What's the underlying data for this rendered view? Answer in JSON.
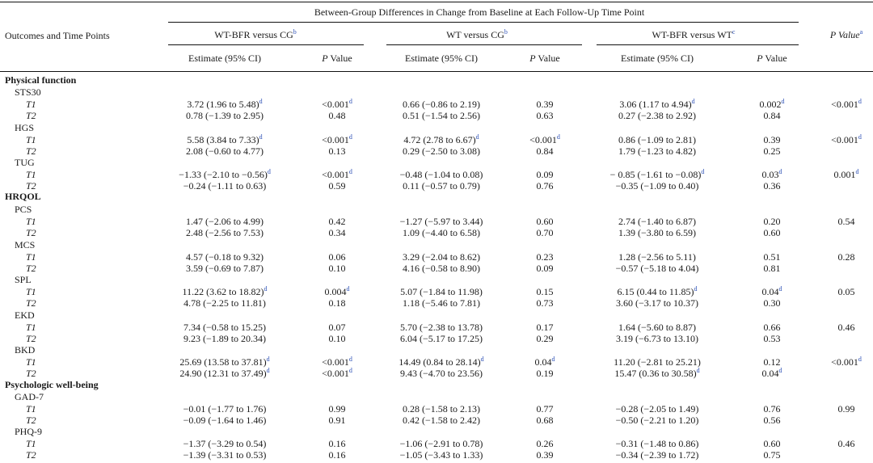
{
  "header": {
    "group_title": "Between-Group Differences in Change from Baseline at Each Follow-Up Time Point",
    "outcomes_col": "Outcomes and Time Points",
    "comparisons": [
      {
        "label": "WT-BFR versus CG",
        "sup": "b"
      },
      {
        "label": "WT versus CG",
        "sup": "b"
      },
      {
        "label": "WT-BFR versus WT",
        "sup": "c"
      }
    ],
    "pvalue_overall": {
      "label": "P Value",
      "sup": "a"
    },
    "estimate_label": "Estimate (95% CI)",
    "pvalue_label": "P Value"
  },
  "sections": [
    "Physical function",
    "HRQOL",
    "Psychologic well-being"
  ],
  "outcomes": [
    {
      "name": "STS30",
      "overall_p": "<0.001",
      "overall_sup": "d",
      "rows": [
        {
          "tp": "T1",
          "cells": [
            {
              "est": "3.72 (1.96 to 5.48)",
              "est_sup": "d",
              "p": "<0.001",
              "p_sup": "d"
            },
            {
              "est": "0.66 (−0.86 to 2.19)",
              "est_sup": "",
              "p": "0.39",
              "p_sup": ""
            },
            {
              "est": "3.06 (1.17 to 4.94)",
              "est_sup": "d",
              "p": "0.002",
              "p_sup": "d"
            }
          ]
        },
        {
          "tp": "T2",
          "cells": [
            {
              "est": "0.78 (−1.39 to 2.95)",
              "est_sup": "",
              "p": "0.48",
              "p_sup": ""
            },
            {
              "est": "0.51 (−1.54 to 2.56)",
              "est_sup": "",
              "p": "0.63",
              "p_sup": ""
            },
            {
              "est": "0.27 (−2.38 to 2.92)",
              "est_sup": "",
              "p": "0.84",
              "p_sup": ""
            }
          ]
        }
      ]
    },
    {
      "name": "HGS",
      "overall_p": "<0.001",
      "overall_sup": "d",
      "rows": [
        {
          "tp": "T1",
          "cells": [
            {
              "est": "5.58 (3.84 to 7.33)",
              "est_sup": "d",
              "p": "<0.001",
              "p_sup": "d"
            },
            {
              "est": "4.72 (2.78 to 6.67)",
              "est_sup": "d",
              "p": "<0.001",
              "p_sup": "d"
            },
            {
              "est": "0.86 (−1.09 to 2.81)",
              "est_sup": "",
              "p": "0.39",
              "p_sup": ""
            }
          ]
        },
        {
          "tp": "T2",
          "cells": [
            {
              "est": "2.08 (−0.60 to 4.77)",
              "est_sup": "",
              "p": "0.13",
              "p_sup": ""
            },
            {
              "est": "0.29 (−2.50 to 3.08)",
              "est_sup": "",
              "p": "0.84",
              "p_sup": ""
            },
            {
              "est": "1.79 (−1.23 to 4.82)",
              "est_sup": "",
              "p": "0.25",
              "p_sup": ""
            }
          ]
        }
      ]
    },
    {
      "name": "TUG",
      "overall_p": "0.001",
      "overall_sup": "d",
      "rows": [
        {
          "tp": "T1",
          "cells": [
            {
              "est": "−1.33 (−2.10 to −0.56)",
              "est_sup": "d",
              "p": "<0.001",
              "p_sup": "d"
            },
            {
              "est": "−0.48 (−1.04 to 0.08)",
              "est_sup": "",
              "p": "0.09",
              "p_sup": ""
            },
            {
              "est": "− 0.85 (−1.61 to −0.08)",
              "est_sup": "d",
              "p": "0.03",
              "p_sup": "d"
            }
          ]
        },
        {
          "tp": "T2",
          "cells": [
            {
              "est": "−0.24 (−1.11 to 0.63)",
              "est_sup": "",
              "p": "0.59",
              "p_sup": ""
            },
            {
              "est": "0.11 (−0.57 to 0.79)",
              "est_sup": "",
              "p": "0.76",
              "p_sup": ""
            },
            {
              "est": "−0.35 (−1.09 to 0.40)",
              "est_sup": "",
              "p": "0.36",
              "p_sup": ""
            }
          ]
        }
      ]
    },
    {
      "name": "PCS",
      "overall_p": "0.54",
      "overall_sup": "",
      "rows": [
        {
          "tp": "T1",
          "cells": [
            {
              "est": "1.47 (−2.06 to 4.99)",
              "est_sup": "",
              "p": "0.42",
              "p_sup": ""
            },
            {
              "est": "−1.27 (−5.97 to 3.44)",
              "est_sup": "",
              "p": "0.60",
              "p_sup": ""
            },
            {
              "est": "2.74 (−1.40 to 6.87)",
              "est_sup": "",
              "p": "0.20",
              "p_sup": ""
            }
          ]
        },
        {
          "tp": "T2",
          "cells": [
            {
              "est": "2.48 (−2.56 to 7.53)",
              "est_sup": "",
              "p": "0.34",
              "p_sup": ""
            },
            {
              "est": "1.09 (−4.40 to 6.58)",
              "est_sup": "",
              "p": "0.70",
              "p_sup": ""
            },
            {
              "est": "1.39 (−3.80 to 6.59)",
              "est_sup": "",
              "p": "0.60",
              "p_sup": ""
            }
          ]
        }
      ]
    },
    {
      "name": "MCS",
      "overall_p": "0.28",
      "overall_sup": "",
      "rows": [
        {
          "tp": "T1",
          "cells": [
            {
              "est": "4.57 (−0.18 to 9.32)",
              "est_sup": "",
              "p": "0.06",
              "p_sup": ""
            },
            {
              "est": "3.29 (−2.04 to 8.62)",
              "est_sup": "",
              "p": "0.23",
              "p_sup": ""
            },
            {
              "est": "1.28 (−2.56 to 5.11)",
              "est_sup": "",
              "p": "0.51",
              "p_sup": ""
            }
          ]
        },
        {
          "tp": "T2",
          "cells": [
            {
              "est": "3.59 (−0.69 to 7.87)",
              "est_sup": "",
              "p": "0.10",
              "p_sup": ""
            },
            {
              "est": "4.16 (−0.58 to 8.90)",
              "est_sup": "",
              "p": "0.09",
              "p_sup": ""
            },
            {
              "est": "−0.57 (−5.18 to 4.04)",
              "est_sup": "",
              "p": "0.81",
              "p_sup": ""
            }
          ]
        }
      ]
    },
    {
      "name": "SPL",
      "overall_p": "0.05",
      "overall_sup": "",
      "rows": [
        {
          "tp": "T1",
          "cells": [
            {
              "est": "11.22 (3.62 to 18.82)",
              "est_sup": "d",
              "p": "0.004",
              "p_sup": "d"
            },
            {
              "est": "5.07 (−1.84 to 11.98)",
              "est_sup": "",
              "p": "0.15",
              "p_sup": ""
            },
            {
              "est": "6.15 (0.44 to 11.85)",
              "est_sup": "d",
              "p": "0.04",
              "p_sup": "d"
            }
          ]
        },
        {
          "tp": "T2",
          "cells": [
            {
              "est": "4.78 (−2.25 to 11.81)",
              "est_sup": "",
              "p": "0.18",
              "p_sup": ""
            },
            {
              "est": "1.18 (−5.46 to 7.81)",
              "est_sup": "",
              "p": "0.73",
              "p_sup": ""
            },
            {
              "est": "3.60 (−3.17 to 10.37)",
              "est_sup": "",
              "p": "0.30",
              "p_sup": ""
            }
          ]
        }
      ]
    },
    {
      "name": "EKD",
      "overall_p": "0.46",
      "overall_sup": "",
      "rows": [
        {
          "tp": "T1",
          "cells": [
            {
              "est": "7.34 (−0.58 to 15.25)",
              "est_sup": "",
              "p": "0.07",
              "p_sup": ""
            },
            {
              "est": "5.70 (−2.38 to 13.78)",
              "est_sup": "",
              "p": "0.17",
              "p_sup": ""
            },
            {
              "est": "1.64 (−5.60 to 8.87)",
              "est_sup": "",
              "p": "0.66",
              "p_sup": ""
            }
          ]
        },
        {
          "tp": "T2",
          "cells": [
            {
              "est": "9.23 (−1.89 to 20.34)",
              "est_sup": "",
              "p": "0.10",
              "p_sup": ""
            },
            {
              "est": "6.04 (−5.17 to 17.25)",
              "est_sup": "",
              "p": "0.29",
              "p_sup": ""
            },
            {
              "est": "3.19 (−6.73 to 13.10)",
              "est_sup": "",
              "p": "0.53",
              "p_sup": ""
            }
          ]
        }
      ]
    },
    {
      "name": "BKD",
      "overall_p": "<0.001",
      "overall_sup": "d",
      "rows": [
        {
          "tp": "T1",
          "cells": [
            {
              "est": "25.69 (13.58 to 37.81)",
              "est_sup": "d",
              "p": "<0.001",
              "p_sup": "d"
            },
            {
              "est": "14.49 (0.84 to 28.14)",
              "est_sup": "d",
              "p": "0.04",
              "p_sup": "d"
            },
            {
              "est": "11.20 (−2.81 to 25.21)",
              "est_sup": "",
              "p": "0.12",
              "p_sup": ""
            }
          ]
        },
        {
          "tp": "T2",
          "cells": [
            {
              "est": "24.90 (12.31 to 37.49)",
              "est_sup": "d",
              "p": "<0.001",
              "p_sup": "d"
            },
            {
              "est": "9.43 (−4.70 to 23.56)",
              "est_sup": "",
              "p": "0.19",
              "p_sup": ""
            },
            {
              "est": "15.47 (0.36 to 30.58)",
              "est_sup": "d",
              "p": "0.04",
              "p_sup": "d"
            }
          ]
        }
      ]
    },
    {
      "name": "GAD-7",
      "overall_p": "0.99",
      "overall_sup": "",
      "rows": [
        {
          "tp": "T1",
          "cells": [
            {
              "est": "−0.01 (−1.77 to 1.76)",
              "est_sup": "",
              "p": "0.99",
              "p_sup": ""
            },
            {
              "est": "0.28 (−1.58 to 2.13)",
              "est_sup": "",
              "p": "0.77",
              "p_sup": ""
            },
            {
              "est": "−0.28 (−2.05 to 1.49)",
              "est_sup": "",
              "p": "0.76",
              "p_sup": ""
            }
          ]
        },
        {
          "tp": "T2",
          "cells": [
            {
              "est": "−0.09 (−1.64 to 1.46)",
              "est_sup": "",
              "p": "0.91",
              "p_sup": ""
            },
            {
              "est": "0.42 (−1.58 to 2.42)",
              "est_sup": "",
              "p": "0.68",
              "p_sup": ""
            },
            {
              "est": "−0.50 (−2.21 to 1.20)",
              "est_sup": "",
              "p": "0.56",
              "p_sup": ""
            }
          ]
        }
      ]
    },
    {
      "name": "PHQ-9",
      "overall_p": "0.46",
      "overall_sup": "",
      "rows": [
        {
          "tp": "T1",
          "cells": [
            {
              "est": "−1.37 (−3.29 to 0.54)",
              "est_sup": "",
              "p": "0.16",
              "p_sup": ""
            },
            {
              "est": "−1.06 (−2.91 to 0.78)",
              "est_sup": "",
              "p": "0.26",
              "p_sup": ""
            },
            {
              "est": "−0.31 (−1.48 to 0.86)",
              "est_sup": "",
              "p": "0.60",
              "p_sup": ""
            }
          ]
        },
        {
          "tp": "T2",
          "cells": [
            {
              "est": "−1.39 (−3.31 to 0.53)",
              "est_sup": "",
              "p": "0.16",
              "p_sup": ""
            },
            {
              "est": "−1.05 (−3.43 to 1.33)",
              "est_sup": "",
              "p": "0.39",
              "p_sup": ""
            },
            {
              "est": "−0.34 (−2.39 to 1.72)",
              "est_sup": "",
              "p": "0.75",
              "p_sup": ""
            }
          ]
        }
      ]
    }
  ]
}
